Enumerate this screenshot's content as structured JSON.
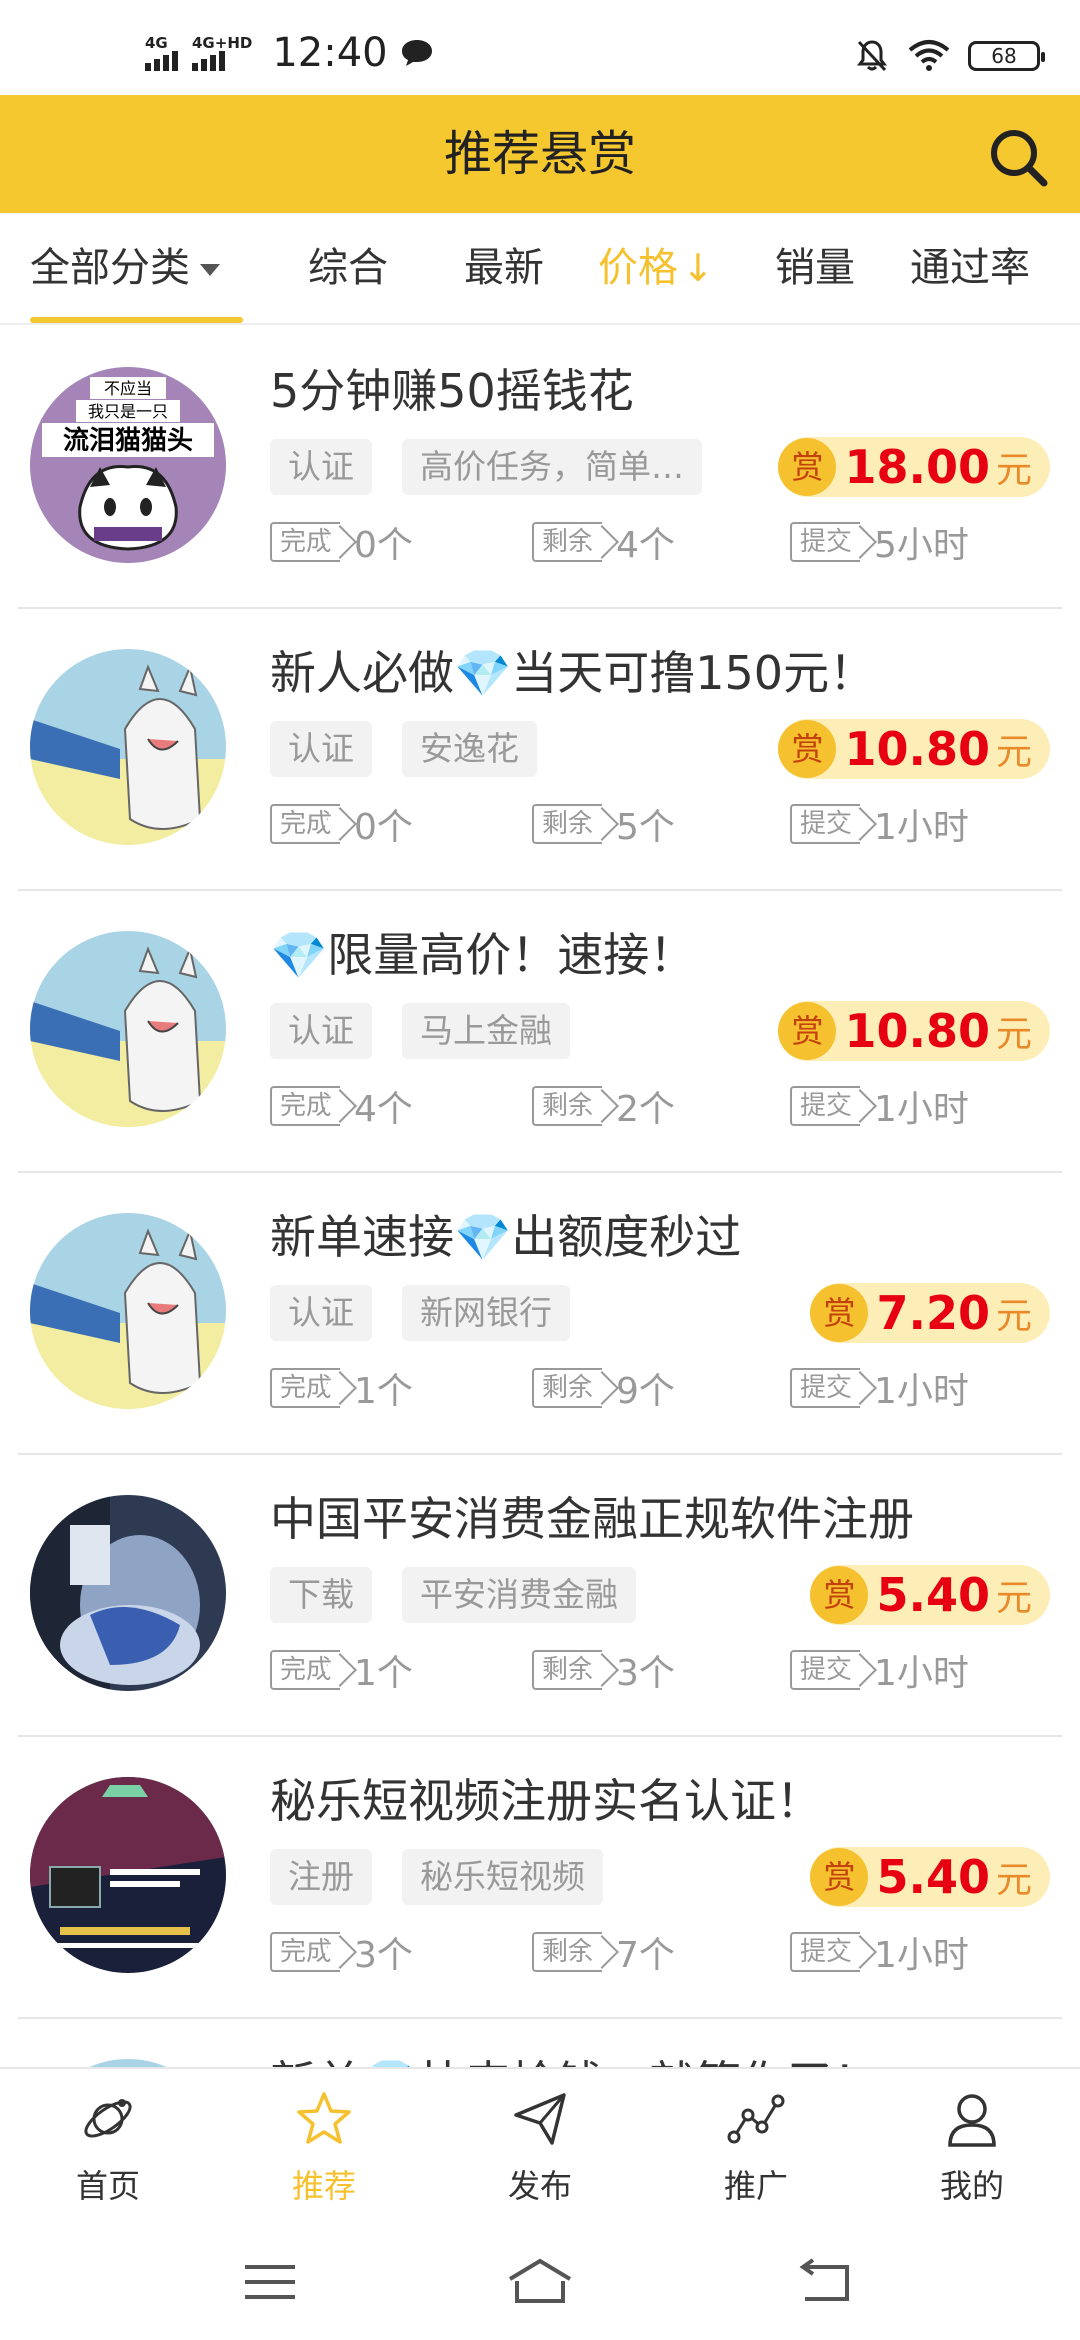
{
  "status_bar": {
    "sim1": "4G",
    "sim2": "4G+HD",
    "time": "12:40",
    "battery": "68"
  },
  "header": {
    "title": "推荐悬赏"
  },
  "filters": {
    "all_category": "全部分类",
    "overall": "综合",
    "newest": "最新",
    "price": "价格",
    "price_arrow": "↓",
    "sales": "销量",
    "pass_rate": "通过率"
  },
  "labels": {
    "reward_char": "赏",
    "unit": "元",
    "done": "完成",
    "remaining": "剩余",
    "submit": "提交"
  },
  "tasks": [
    {
      "title": "5分钟赚50摇钱花",
      "tag1": "认证",
      "tag2": "高价任务，简单…",
      "price": "18.00",
      "done": "0个",
      "remaining": "4个",
      "submit": "5小时",
      "avatar_text1": "不应当",
      "avatar_text2": "我只是一只",
      "avatar_text3": "流泪猫猫头"
    },
    {
      "title": "新人必做💎当天可撸150元！",
      "tag1": "认证",
      "tag2": "安逸花",
      "price": "10.80",
      "done": "0个",
      "remaining": "5个",
      "submit": "1小时"
    },
    {
      "title": "💎限量高价！速接！",
      "tag1": "认证",
      "tag2": "马上金融",
      "price": "10.80",
      "done": "4个",
      "remaining": "2个",
      "submit": "1小时"
    },
    {
      "title": "新单速接💎出额度秒过",
      "tag1": "认证",
      "tag2": "新网银行",
      "price": "7.20",
      "done": "1个",
      "remaining": "9个",
      "submit": "1小时"
    },
    {
      "title": "中国平安消费金融正规软件注册",
      "tag1": "下载",
      "tag2": "平安消费金融",
      "price": "5.40",
      "done": "1个",
      "remaining": "3个",
      "submit": "1小时"
    },
    {
      "title": "秘乐短视频注册实名认证！",
      "tag1": "注册",
      "tag2": "秘乐短视频",
      "price": "5.40",
      "done": "3个",
      "remaining": "7个",
      "submit": "1小时"
    },
    {
      "title": "新单💎快来捡钱，就等你了！"
    }
  ],
  "bottom_nav": {
    "home": "首页",
    "recommend": "推荐",
    "publish": "发布",
    "promote": "推广",
    "mine": "我的"
  },
  "colors": {
    "accent": "#f6c830",
    "price": "#e60012"
  }
}
